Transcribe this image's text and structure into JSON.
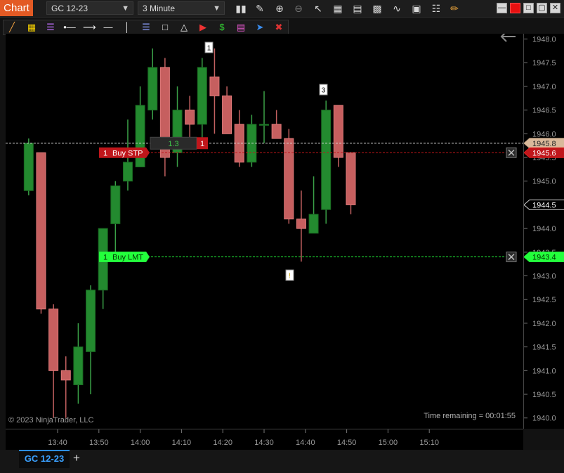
{
  "window": {
    "title": "Chart",
    "instrument": "GC 12-23",
    "interval": "3 Minute"
  },
  "toolbar_icons": [
    "bar-chart-icon",
    "pencil-icon",
    "zoom-in-icon",
    "zoom-out-icon",
    "pointer-icon",
    "data-box-icon",
    "bar-style-icon",
    "line-style-icon",
    "properties-icon",
    "draw-icon"
  ],
  "drawing_tools": [
    "ruler-icon",
    "risk-reward-icon",
    "fib-icon",
    "extended-line-icon",
    "arrow-line-icon",
    "horizontal-line-icon",
    "vertical-line-icon",
    "parallel-lines-icon",
    "rectangle-icon",
    "triangle-icon",
    "order-entry-icon",
    "dollar-icon",
    "chart-trader-icon",
    "arrow-icon",
    "remove-drawing-icon"
  ],
  "chart": {
    "copyright": "© 2023 NinjaTrader, LLC",
    "time_remaining": "Time remaining = 00:01:55",
    "buy_stp": {
      "qty": "1",
      "label": "Buy STP",
      "price_label": "1945.6",
      "price": 1945.6
    },
    "buy_lmt": {
      "qty": "1",
      "label": "Buy LMT",
      "price_label": "1943.4",
      "price": 1943.4
    },
    "position_box": {
      "value": "1.3",
      "qty": "1"
    },
    "ask_label": "1945.8",
    "last_price_label": "1944.5",
    "markers": [
      {
        "label": "1"
      },
      {
        "label": "3"
      },
      {
        "label": "!"
      }
    ],
    "colors": {
      "up": "#2ea33a",
      "down": "#e46a6a",
      "buy_stp": "#c0161b",
      "buy_lmt": "#23ff3c",
      "ask": "#d9b99b"
    }
  },
  "chart_data": {
    "type": "candlestick",
    "y_ticks": [
      "1948.0",
      "1947.5",
      "1947.0",
      "1946.5",
      "1946.0",
      "1945.5",
      "1945.0",
      "1944.5",
      "1944.0",
      "1943.5",
      "1943.0",
      "1942.5",
      "1942.0",
      "1941.5",
      "1941.0",
      "1940.5",
      "1940.0"
    ],
    "ylim": [
      1939.9,
      1948.3
    ],
    "x_ticks": [
      "13:40",
      "13:50",
      "14:00",
      "14:10",
      "14:20",
      "14:30",
      "14:40",
      "14:50",
      "15:00",
      "15:10"
    ],
    "candles": [
      {
        "time": "13:33",
        "open": 1944.8,
        "high": 1945.9,
        "low": 1944.7,
        "close": 1945.8
      },
      {
        "time": "13:36",
        "open": 1945.6,
        "high": 1945.6,
        "low": 1942.2,
        "close": 1942.3
      },
      {
        "time": "13:39",
        "open": 1942.3,
        "high": 1942.4,
        "low": 1940.0,
        "close": 1941.0
      },
      {
        "time": "13:42",
        "open": 1941.0,
        "high": 1941.3,
        "low": 1940.0,
        "close": 1940.8
      },
      {
        "time": "13:45",
        "open": 1940.7,
        "high": 1942.0,
        "low": 1940.3,
        "close": 1941.5
      },
      {
        "time": "13:48",
        "open": 1941.4,
        "high": 1942.8,
        "low": 1940.5,
        "close": 1942.7
      },
      {
        "time": "13:51",
        "open": 1942.7,
        "high": 1944.0,
        "low": 1942.3,
        "close": 1944.0
      },
      {
        "time": "13:54",
        "open": 1944.1,
        "high": 1945.0,
        "low": 1943.5,
        "close": 1944.9
      },
      {
        "time": "13:57",
        "open": 1945.0,
        "high": 1946.3,
        "low": 1944.8,
        "close": 1945.4
      },
      {
        "time": "14:00",
        "open": 1945.3,
        "high": 1947.0,
        "low": 1945.3,
        "close": 1946.6
      },
      {
        "time": "14:03",
        "open": 1946.5,
        "high": 1947.8,
        "low": 1946.3,
        "close": 1947.4
      },
      {
        "time": "14:06",
        "open": 1947.4,
        "high": 1947.6,
        "low": 1945.1,
        "close": 1945.5
      },
      {
        "time": "14:09",
        "open": 1945.6,
        "high": 1947.0,
        "low": 1945.3,
        "close": 1946.5
      },
      {
        "time": "14:12",
        "open": 1946.5,
        "high": 1946.8,
        "low": 1945.9,
        "close": 1946.2
      },
      {
        "time": "14:15",
        "open": 1946.2,
        "high": 1947.6,
        "low": 1945.9,
        "close": 1947.4
      },
      {
        "time": "14:18",
        "open": 1947.2,
        "high": 1947.8,
        "low": 1946.0,
        "close": 1946.8
      },
      {
        "time": "14:21",
        "open": 1946.8,
        "high": 1947.0,
        "low": 1946.0,
        "close": 1946.0
      },
      {
        "time": "14:24",
        "open": 1946.2,
        "high": 1946.5,
        "low": 1945.3,
        "close": 1945.4
      },
      {
        "time": "14:27",
        "open": 1945.4,
        "high": 1946.4,
        "low": 1945.3,
        "close": 1946.2
      },
      {
        "time": "14:30",
        "open": 1946.2,
        "high": 1946.9,
        "low": 1945.8,
        "close": 1946.2
      },
      {
        "time": "14:33",
        "open": 1946.2,
        "high": 1946.5,
        "low": 1945.9,
        "close": 1945.9
      },
      {
        "time": "14:36",
        "open": 1945.9,
        "high": 1946.1,
        "low": 1944.1,
        "close": 1944.2
      },
      {
        "time": "14:39",
        "open": 1944.2,
        "high": 1944.8,
        "low": 1943.3,
        "close": 1944.0
      },
      {
        "time": "14:42",
        "open": 1943.9,
        "high": 1945.1,
        "low": 1943.9,
        "close": 1944.3
      },
      {
        "time": "14:45",
        "open": 1944.4,
        "high": 1946.7,
        "low": 1944.1,
        "close": 1946.5
      },
      {
        "time": "14:48",
        "open": 1946.6,
        "high": 1946.6,
        "low": 1945.3,
        "close": 1945.5
      },
      {
        "time": "14:51",
        "open": 1945.6,
        "high": 1945.6,
        "low": 1944.3,
        "close": 1944.5
      }
    ]
  }
}
